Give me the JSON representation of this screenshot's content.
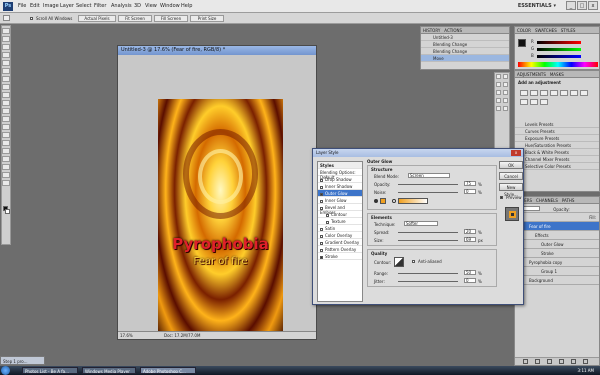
{
  "menubar": {
    "items": [
      "File",
      "Edit",
      "Image",
      "Layer",
      "Select",
      "Filter",
      "Analysis",
      "3D",
      "View",
      "Window",
      "Help"
    ],
    "workspace": "ESSENTIALS ▾",
    "win_min": "_",
    "win_max": "□",
    "win_close": "x"
  },
  "optbar": {
    "scroll_all_label": "Scroll All Windows",
    "buttons": [
      "Actual Pixels",
      "Fit Screen",
      "Fill Screen",
      "Print Size"
    ]
  },
  "document": {
    "title": "Untitled-3 @ 17.6% (Fear of fire, RGB/8) *",
    "art_title": "Pyrophobia",
    "art_subtitle": "Fear of fire",
    "zoom": "17.6%",
    "doc_size": "Doc: 17.2M/77.0M"
  },
  "history": {
    "tabs": [
      "HISTORY",
      "ACTIONS"
    ],
    "rows": [
      "Untitled-3",
      "Blending Change",
      "Blending Change",
      "Move"
    ]
  },
  "color_panel": {
    "tabs": [
      "COLOR",
      "SWATCHES",
      "STYLES"
    ],
    "channels": [
      "R",
      "G",
      "B"
    ]
  },
  "adjustments": {
    "tabs": [
      "ADJUSTMENTS",
      "MASKS"
    ],
    "heading": "Add an adjustment",
    "presets": [
      "Levels Presets",
      "Curves Presets",
      "Exposure Presets",
      "Hue/Saturation Presets",
      "Black & White Presets",
      "Channel Mixer Presets",
      "Selective Color Presets"
    ]
  },
  "layers_panel": {
    "tabs": [
      "LAYERS",
      "CHANNELS",
      "PATHS"
    ],
    "opacity_label": "Opacity:",
    "fill_label": "Fill:",
    "rows": [
      "Fear of fire",
      "Effects",
      "Outer Glow",
      "Stroke",
      "Pyrophobia copy",
      "Group 1",
      "Background"
    ]
  },
  "layer_style": {
    "title": "Layer Style",
    "styles_header": "Styles",
    "styles": [
      "Blending Options: Default",
      "Drop Shadow",
      "Inner Shadow",
      "Outer Glow",
      "Inner Glow",
      "Bevel and Emboss",
      "Contour",
      "Texture",
      "Satin",
      "Color Overlay",
      "Gradient Overlay",
      "Pattern Overlay",
      "Stroke"
    ],
    "outer_glow_title": "Outer Glow",
    "structure_title": "Structure",
    "blend_mode_label": "Blend Mode:",
    "blend_mode": "Screen",
    "opacity_label": "Opacity:",
    "opacity": "75",
    "noise_label": "Noise:",
    "noise": "0",
    "elements_title": "Elements",
    "technique_label": "Technique:",
    "technique": "Softer",
    "spread_label": "Spread:",
    "spread": "20",
    "size_label": "Size:",
    "size": "69",
    "quality_title": "Quality",
    "contour_label": "Contour:",
    "antialiased_label": "Anti-aliased",
    "range_label": "Range:",
    "range": "50",
    "jitter_label": "Jitter:",
    "jitter": "0",
    "pct": "%",
    "px": "px",
    "ok": "OK",
    "cancel": "Cancel",
    "new_style": "New Style...",
    "preview": "Preview"
  },
  "taskbar": {
    "minidoc": "Step 1 pro...",
    "tasks": [
      "Photos List - Be A fa...",
      "Windows Media Player",
      "Adobe Photoshop C..."
    ],
    "clock": "3:11 AM"
  },
  "colors": {
    "accent": "#3d74c9",
    "glow": "#f0a020",
    "art_title": "#e0202a"
  }
}
